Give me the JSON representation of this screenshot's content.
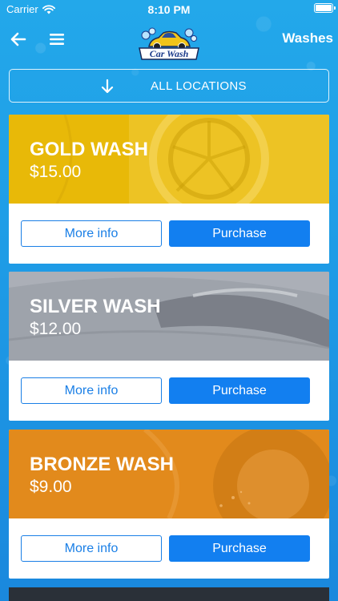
{
  "status_bar": {
    "carrier": "Carrier",
    "time": "8:10 PM"
  },
  "nav": {
    "back_icon": "arrow-left-icon",
    "menu_icon": "hamburger-menu-icon",
    "logo_text": "Car Wash",
    "title": "Washes"
  },
  "locations": {
    "icon": "arrow-down-icon",
    "label": "ALL LOCATIONS"
  },
  "washes": [
    {
      "name": "GOLD WASH",
      "price": "$15.00",
      "tint": "#e8b908",
      "more_label": "More info",
      "buy_label": "Purchase"
    },
    {
      "name": "SILVER WASH",
      "price": "$12.00",
      "tint": "#9ea3ab",
      "more_label": "More info",
      "buy_label": "Purchase"
    },
    {
      "name": "BRONZE WASH",
      "price": "$9.00",
      "tint": "#e28a1c",
      "more_label": "More info",
      "buy_label": "Purchase"
    }
  ],
  "colors": {
    "background": "#1e9be6",
    "accent": "#127ff0",
    "outline": "#1a7fe6"
  }
}
